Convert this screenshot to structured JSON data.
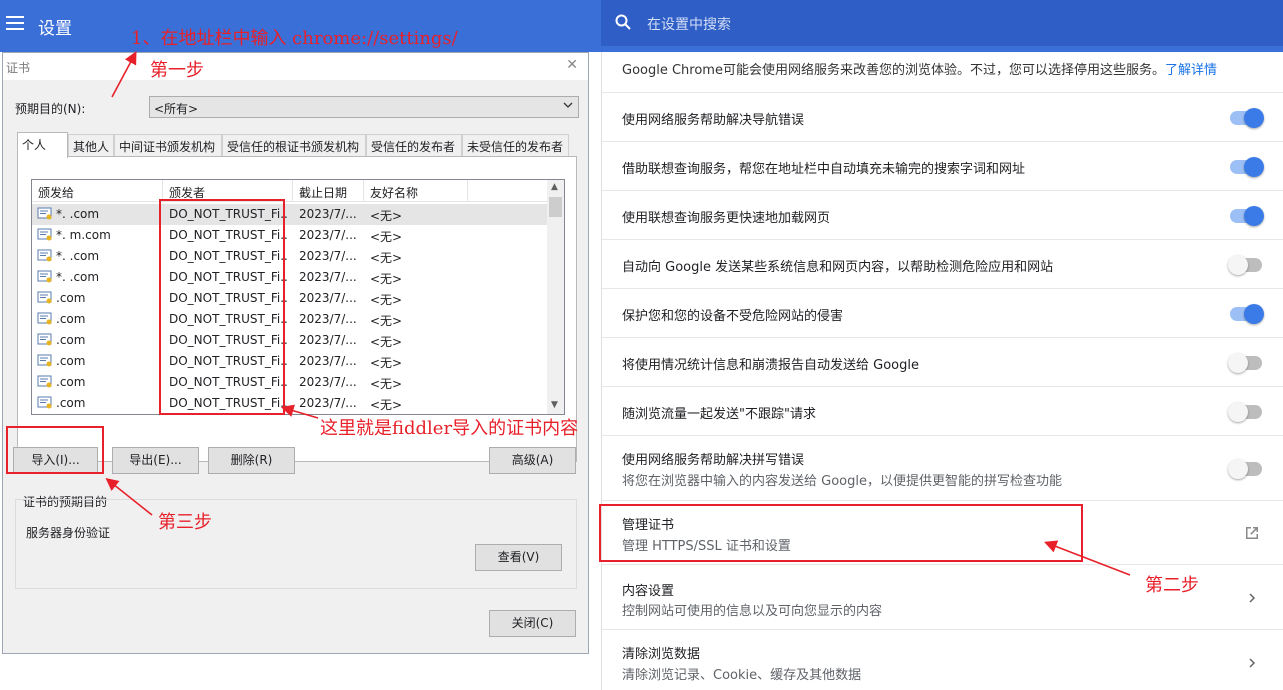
{
  "header": {
    "title": "设置",
    "search_placeholder": "在设置中搜索"
  },
  "settings": {
    "intro_text": "Google Chrome可能会使用网络服务来改善您的浏览体验。不过，您可以选择停用这些服务。",
    "intro_link": "了解详情",
    "toggles": [
      {
        "label": "使用网络服务帮助解决导航错误",
        "on": true
      },
      {
        "label": "借助联想查询服务，帮您在地址栏中自动填充未输完的搜索字词和网址",
        "on": true
      },
      {
        "label": "使用联想查询服务更快速地加载网页",
        "on": true
      },
      {
        "label": "自动向 Google 发送某些系统信息和网页内容，以帮助检测危险应用和网站",
        "on": false
      },
      {
        "label": "保护您和您的设备不受危险网站的侵害",
        "on": true
      },
      {
        "label": "将使用情况统计信息和崩溃报告自动发送给 Google",
        "on": false
      },
      {
        "label": "随浏览流量一起发送\"不跟踪\"请求",
        "on": false
      },
      {
        "label": "使用网络服务帮助解决拼写错误",
        "sub": "将您在浏览器中输入的内容发送给 Google，以便提供更智能的拼写检查功能",
        "on": false
      }
    ],
    "manage_certs": {
      "label": "管理证书",
      "sub": "管理 HTTPS/SSL 证书和设置"
    },
    "content_settings": {
      "label": "内容设置",
      "sub": "控制网站可使用的信息以及可向您显示的内容"
    },
    "clear_data": {
      "label": "清除浏览数据",
      "sub": "清除浏览记录、Cookie、缓存及其他数据"
    }
  },
  "dialog": {
    "title": "证书",
    "purpose_label": "预期目的(N):",
    "purpose_value": "<所有>",
    "tabs": [
      "个人",
      "其他人",
      "中间证书颁发机构",
      "受信任的根证书颁发机构",
      "受信任的发布者",
      "未受信任的发布者"
    ],
    "columns": [
      "颁发给",
      "颁发者",
      "截止日期",
      "友好名称"
    ],
    "rows": [
      {
        "issued_to": "*.        .com",
        "issuer": "DO_NOT_TRUST_Fi...",
        "expires": "2023/7/...",
        "friendly": "<无>"
      },
      {
        "issued_to": "*.          m.com",
        "issuer": "DO_NOT_TRUST_Fi...",
        "expires": "2023/7/...",
        "friendly": "<无>"
      },
      {
        "issued_to": "*.           .com",
        "issuer": "DO_NOT_TRUST_Fi...",
        "expires": "2023/7/...",
        "friendly": "<无>"
      },
      {
        "issued_to": "*.         .com",
        "issuer": "DO_NOT_TRUST_Fi...",
        "expires": "2023/7/...",
        "friendly": "<无>"
      },
      {
        "issued_to": "         .com",
        "issuer": "DO_NOT_TRUST_Fi...",
        "expires": "2023/7/...",
        "friendly": "<无>"
      },
      {
        "issued_to": "          .com",
        "issuer": "DO_NOT_TRUST_Fi...",
        "expires": "2023/7/...",
        "friendly": "<无>"
      },
      {
        "issued_to": "           .com",
        "issuer": "DO_NOT_TRUST_Fi...",
        "expires": "2023/7/...",
        "friendly": "<无>"
      },
      {
        "issued_to": "          .com",
        "issuer": "DO_NOT_TRUST_Fi...",
        "expires": "2023/7/...",
        "friendly": "<无>"
      },
      {
        "issued_to": "          .com",
        "issuer": "DO_NOT_TRUST_Fi...",
        "expires": "2023/7/...",
        "friendly": "<无>"
      },
      {
        "issued_to": "          .com",
        "issuer": "DO_NOT_TRUST_Fi...",
        "expires": "2023/7/...",
        "friendly": "<无>"
      }
    ],
    "buttons": {
      "import": "导入(I)...",
      "export": "导出(E)...",
      "remove": "删除(R)",
      "advanced": "高级(A)",
      "view": "查看(V)",
      "close": "关闭(C)"
    },
    "purpose_group_label": "证书的预期目的",
    "purpose_group_value": "服务器身份验证"
  },
  "annotations": {
    "step1_title": "1、在地址栏中输入 chrome://settings/",
    "step1": "第一步",
    "step2": "第二步",
    "step3": "第三步",
    "fiddler_note": "这里就是fiddler导入的证书内容"
  }
}
